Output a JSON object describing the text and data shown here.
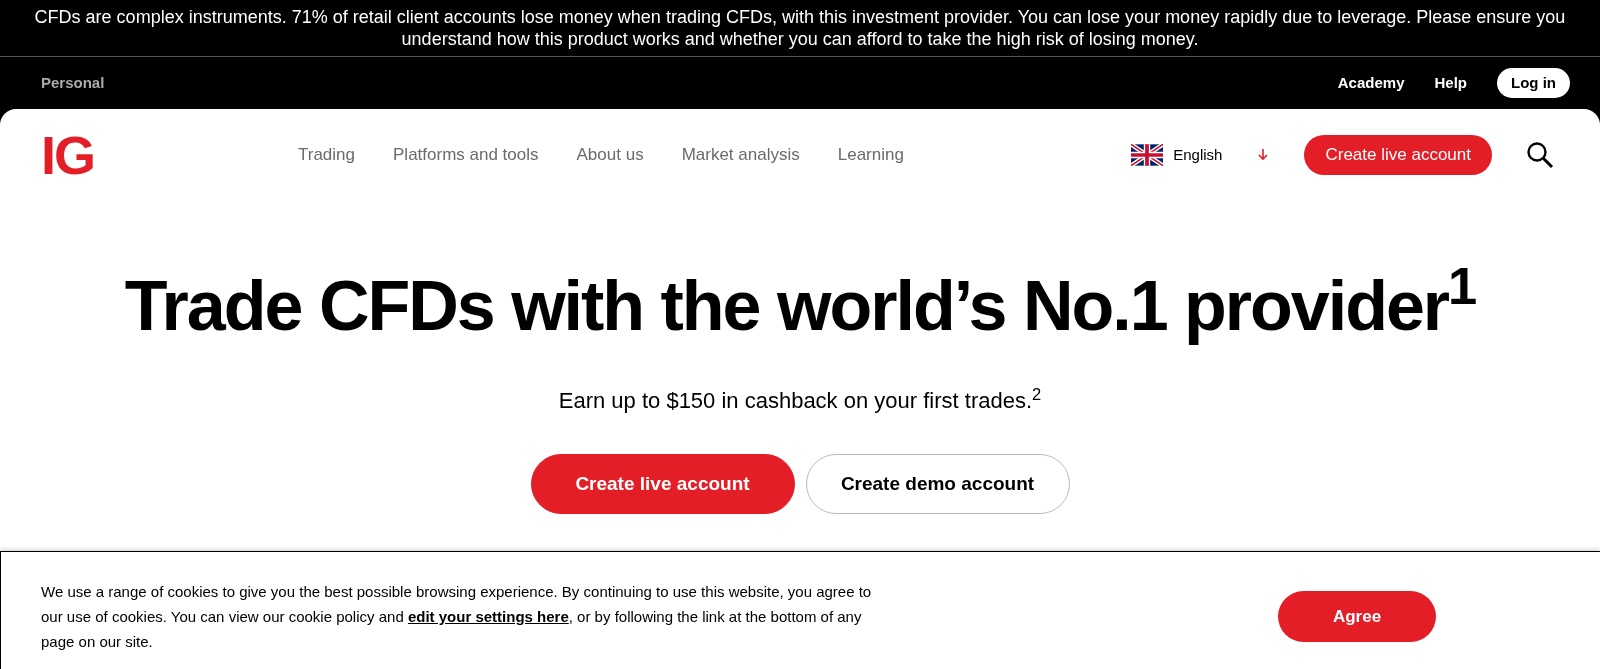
{
  "risk_warning": "CFDs are complex instruments. 71% of retail client accounts lose money when trading CFDs, with this investment provider. You can lose your money rapidly due to leverage. Please ensure you understand how this product works and whether you can afford to take the high risk of losing money.",
  "top_bar": {
    "segment": "Personal",
    "links": [
      "Academy",
      "Help"
    ],
    "login": "Log in"
  },
  "nav": {
    "logo": "IG",
    "items": [
      "Trading",
      "Platforms and tools",
      "About us",
      "Market analysis",
      "Learning"
    ],
    "language": "English",
    "cta": "Create live account"
  },
  "hero": {
    "title": "Trade CFDs with the world’s No.1 provider$^{1}$",
    "subtitle": "Earn up to $150 in cashback on your first trades.$^{2}$",
    "buttons": [
      {
        "label": "Create live account",
        "kind": "primary"
      },
      {
        "label": "Create demo account",
        "kind": "secondary"
      }
    ]
  },
  "cookie_banner": {
    "text_before": "We use a range of cookies to give you the best possible browsing experience. By continuing to use this website, you agree to our use of cookies. You can view our cookie policy and ",
    "link": "edit your settings here",
    "text_after": ", or by following the link at the bottom of any page on our site.",
    "button": "Agree"
  }
}
